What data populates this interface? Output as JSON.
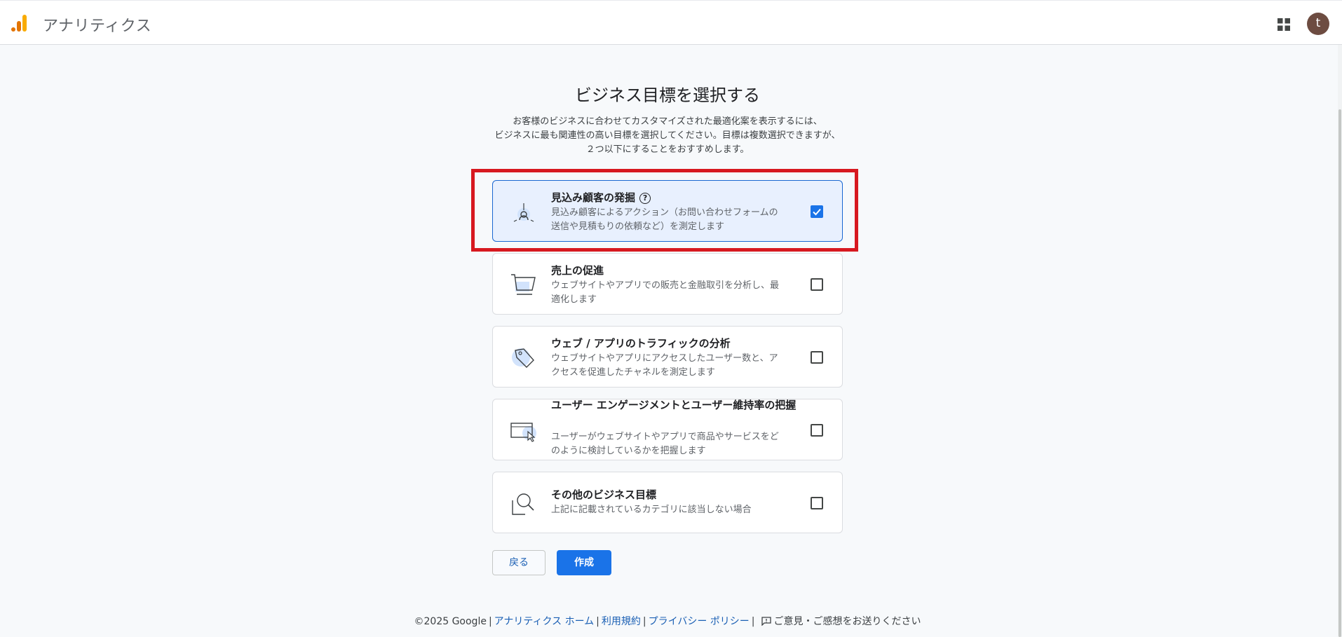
{
  "header": {
    "app_title": "アナリティクス",
    "avatar_initial": "t",
    "logo_colors": [
      "#f9ab00",
      "#e37400"
    ]
  },
  "main": {
    "title": "ビジネス目標を選択する",
    "description": [
      "お客様のビジネスに合わせてカスタマイズされた最適化案を表示するには、",
      "ビジネスに最も関連性の高い目標を選択してください。目標は複数選択できますが、",
      "２つ以下にすることをおすすめします。"
    ],
    "options": [
      {
        "title": "見込み顧客の発掘",
        "desc_lines": [
          "見込み顧客によるアクション（お問い合わせフォームの",
          "送信や見積もりの依頼など）を測定します"
        ],
        "icon": "lead-target-icon",
        "checked": true,
        "has_help": true
      },
      {
        "title": "売上の促進",
        "desc_lines": [
          "ウェブサイトやアプリでの販売と金融取引を分析し、最",
          "適化します"
        ],
        "icon": "shopping-cart-icon",
        "checked": false
      },
      {
        "title": "ウェブ / アプリのトラフィックの分析",
        "desc_lines": [
          "ウェブサイトやアプリにアクセスしたユーザー数と、ア",
          "クセスを促進したチャネルを測定します"
        ],
        "icon": "tag-icon",
        "checked": false
      },
      {
        "title": "ユーザー エンゲージメントとユーザー維持率の把握",
        "desc_lines": [
          "ユーザーがウェブサイトやアプリで商品やサービスをど",
          "のように検討しているかを把握します"
        ],
        "icon": "browser-cursor-icon",
        "checked": false
      },
      {
        "title": "その他のビジネス目標",
        "desc_lines": [
          "上記に記載されているカテゴリに該当しない場合"
        ],
        "icon": "magnifier-document-icon",
        "checked": false
      }
    ],
    "back_label": "戻る",
    "create_label": "作成"
  },
  "footer": {
    "copyright": "©2025 Google",
    "links": [
      "アナリティクス ホーム",
      "利用規約",
      "プライバシー ポリシー"
    ],
    "feedback": "ご意見・ご感想をお送りください"
  },
  "colors": {
    "accent": "#1a73e8",
    "selected_bg": "#e8f0fe",
    "highlight": "#d71920"
  }
}
